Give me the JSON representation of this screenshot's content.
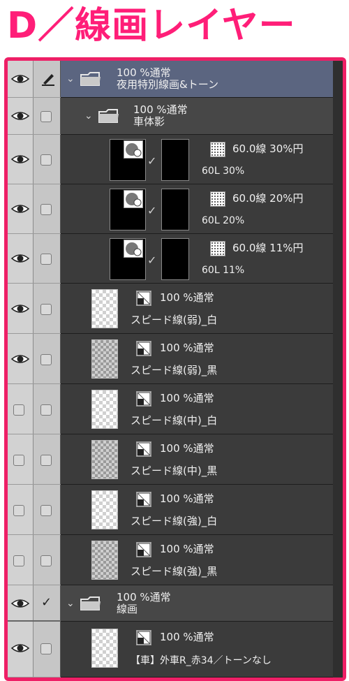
{
  "title": "D／線画レイヤー",
  "rows": {
    "f1": {
      "mode": "100 %通常",
      "name": "夜用特別線画&トーン"
    },
    "f2": {
      "mode": "100 %通常",
      "name": "車体影"
    },
    "t1": {
      "tone": "60.0線 30%円",
      "name": "60L 30%"
    },
    "t2": {
      "tone": "60.0線 20%円",
      "name": "60L 20%"
    },
    "t3": {
      "tone": "60.0線 11%円",
      "name": "60L 11%"
    },
    "l1": {
      "mode": "100 %通常",
      "name": "スピード線(弱)_白"
    },
    "l2": {
      "mode": "100 %通常",
      "name": "スピード線(弱)_黒"
    },
    "l3": {
      "mode": "100 %通常",
      "name": "スピード線(中)_白"
    },
    "l4": {
      "mode": "100 %通常",
      "name": "スピード線(中)_黒"
    },
    "l5": {
      "mode": "100 %通常",
      "name": "スピード線(強)_白"
    },
    "l6": {
      "mode": "100 %通常",
      "name": "スピード線(強)_黒"
    },
    "f3": {
      "mode": "100 %通常",
      "name": "線画"
    },
    "l7": {
      "mode": "100 %通常",
      "name": "【車】外車R_赤34／トーンなし"
    }
  },
  "icons": {
    "visibility": "eye-icon",
    "edit": "pen-icon",
    "folder": "folder-icon",
    "expand": "chevron-down-icon",
    "layer_type": "raster-layer-icon",
    "tone": "tone-icon",
    "mask": "mask-icon"
  },
  "colors": {
    "title": "#ff1e78",
    "frame": "#ee1f66",
    "selected_folder": "#5b6580",
    "panel_bg": "#3b3b3b"
  }
}
